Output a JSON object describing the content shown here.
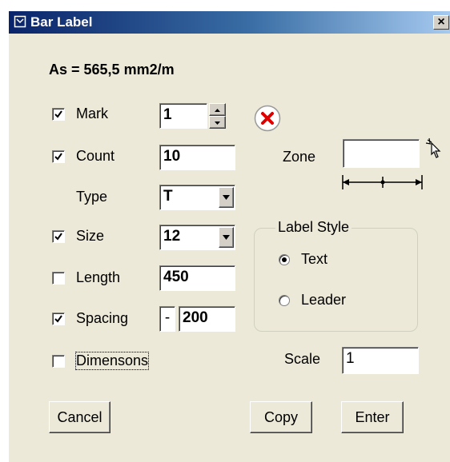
{
  "window": {
    "title": "Bar Label",
    "close_label": "×"
  },
  "area_text": "As = 565,5 mm2/m",
  "mark": {
    "label": "Mark",
    "checked": true,
    "value": "1"
  },
  "count": {
    "label": "Count",
    "checked": true,
    "value": "10"
  },
  "type": {
    "label": "Type",
    "value": "T"
  },
  "size": {
    "label": "Size",
    "checked": true,
    "value": "12"
  },
  "length": {
    "label": "Length",
    "checked": false,
    "value": "450"
  },
  "spacing": {
    "label": "Spacing",
    "checked": true,
    "prefix": "-",
    "value": "200"
  },
  "dimensions": {
    "label": "Dimensons",
    "checked": false
  },
  "zone": {
    "label": "Zone",
    "value": ""
  },
  "label_style": {
    "title": "Label Style",
    "options": [
      {
        "label": "Text",
        "selected": true
      },
      {
        "label": "Leader",
        "selected": false
      }
    ]
  },
  "scale": {
    "label": "Scale",
    "value": "1"
  },
  "buttons": {
    "cancel": "Cancel",
    "copy": "Copy",
    "enter": "Enter"
  },
  "colors": {
    "title_start": "#0a246a",
    "title_end": "#a6caf0",
    "dialog_bg": "#ece9d8",
    "delete_red": "#e00000"
  }
}
